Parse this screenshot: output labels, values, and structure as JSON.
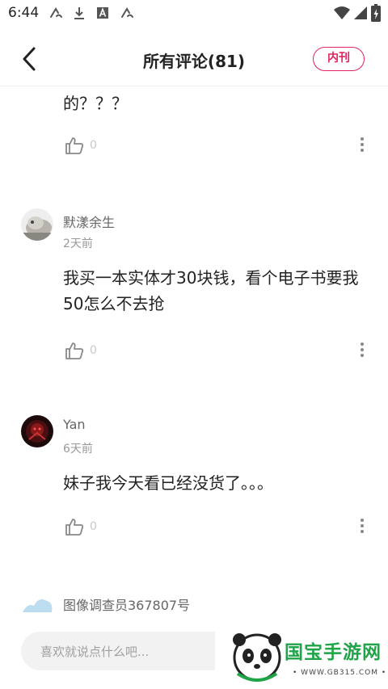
{
  "status_bar": {
    "time": "6:44",
    "left_icons": [
      "app-notification-icon",
      "download-icon",
      "a-box-icon",
      "app-notification-icon"
    ],
    "right_icons": [
      "wifi-icon",
      "signal-icon",
      "battery-icon"
    ]
  },
  "header": {
    "title": "所有评论(81)",
    "journal_button": "内刊",
    "accent_color": "#e0245e"
  },
  "comments": [
    {
      "content": "的？？？",
      "likes": "0"
    },
    {
      "username": "默漾余生",
      "time": "2天前",
      "content": "我买一本实体才30块钱，看个电子书要我50怎么不去抢",
      "likes": "0"
    },
    {
      "username": "Yan",
      "time": "6天前",
      "content": "妹子我今天看已经没货了。。。",
      "likes": "0"
    },
    {
      "username": "图像调查员367807号"
    }
  ],
  "comment_input": {
    "placeholder": "喜欢就说点什么吧..."
  },
  "watermark": {
    "site_name": "国宝手游网",
    "url": "• WWW.GB315.COM •"
  }
}
